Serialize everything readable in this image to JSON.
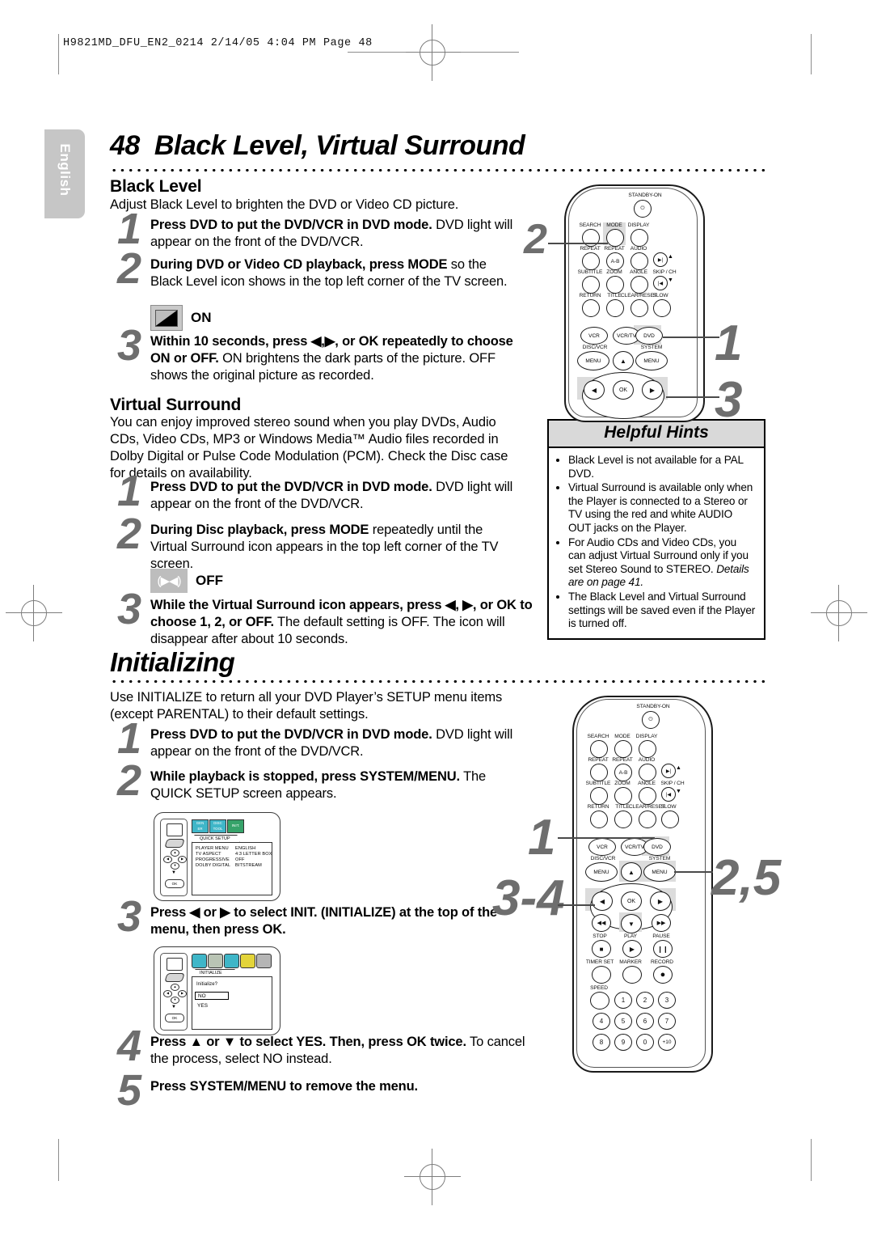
{
  "document": {
    "slug": "H9821MD_DFU_EN2_0214   2/14/05   4:04 PM   Page 48",
    "language_tab": "English",
    "page_number": "48",
    "page_title": "Black Level, Virtual Surround"
  },
  "black_level": {
    "heading": "Black Level",
    "intro": "Adjust Black Level to brighten the DVD or Video CD picture.",
    "steps": [
      {
        "n": "1",
        "bold": "Press DVD to put the DVD/VCR in DVD mode.",
        "rest": " DVD light will appear on the front of the DVD/VCR."
      },
      {
        "n": "2",
        "bold": "During DVD or Video CD playback, press MODE",
        "rest": " so the Black Level icon shows in the top left corner of the TV screen."
      },
      {
        "n": "3",
        "bold": "Within 10 seconds, press ◀,▶, or OK repeatedly to choose ON or OFF.",
        "rest": " ON brightens the dark parts of the picture. OFF shows the original picture as recorded."
      }
    ],
    "osd_icon_label": "ON",
    "osd_icon_name": "black-level-on-icon"
  },
  "virtual_surround": {
    "heading": "Virtual Surround",
    "intro": "You can enjoy improved stereo sound when you play DVDs, Audio CDs, Video CDs, MP3 or Windows Media™ Audio files recorded in Dolby Digital or Pulse Code Modulation (PCM). Check the Disc case for details on availability.",
    "steps": [
      {
        "n": "1",
        "bold": "Press DVD to put the DVD/VCR in DVD mode.",
        "rest": " DVD light will appear on the front of the DVD/VCR."
      },
      {
        "n": "2",
        "bold": "During Disc playback, press MODE",
        "rest": " repeatedly until the Virtual Surround icon appears in the top left corner of the TV screen."
      },
      {
        "n": "3",
        "bold": "While the Virtual Surround icon appears, press ◀, ▶, or OK to choose 1, 2, or OFF.",
        "rest": " The default setting is OFF. The icon will disappear after about 10 seconds."
      }
    ],
    "osd_icon_label": "OFF",
    "osd_icon_glyph": "(▶◀)"
  },
  "helpful_hints": {
    "title": "Helpful Hints",
    "items": [
      {
        "text": "Black Level is not available for a PAL DVD.",
        "italic": ""
      },
      {
        "text": "Virtual Surround is available only when the Player is connected to a Stereo or TV using the red and white AUDIO OUT jacks on the Player.",
        "italic": ""
      },
      {
        "text": "For Audio CDs and Video CDs, you can adjust Virtual Surround only if you set Stereo Sound to STEREO. ",
        "italic": "Details are on page 41."
      },
      {
        "text": "The Black Level and Virtual Surround settings will be saved even if the Player is turned off.",
        "italic": ""
      }
    ]
  },
  "initializing": {
    "heading": "Initializing",
    "intro": "Use INITIALIZE to return all your DVD Player’s SETUP menu items (except PARENTAL) to their default settings.",
    "steps": [
      {
        "n": "1",
        "bold": "Press DVD to put the DVD/VCR in DVD mode.",
        "rest": " DVD light will appear on the front of the DVD/VCR."
      },
      {
        "n": "2",
        "bold": "While playback is stopped, press SYSTEM/MENU.",
        "rest": " The QUICK SETUP screen appears."
      },
      {
        "n": "3",
        "bold": "Press ◀ or ▶ to select INIT. (INITIALIZE) at the top of the menu, then press OK.",
        "rest": ""
      },
      {
        "n": "4",
        "bold": "Press ▲ or ▼ to select YES. Then, press OK twice.",
        "rest": " To cancel the process, select NO instead."
      },
      {
        "n": "5",
        "bold": "Press SYSTEM/MENU to remove the menu.",
        "rest": ""
      }
    ]
  },
  "osd_quick_setup": {
    "tab": "QUICK SETUP",
    "tabs_icons": [
      "GENERAL",
      "DISC/TOOLS",
      "INIT."
    ],
    "rows": [
      {
        "label": "PLAYER MENU",
        "value": "ENGLISH"
      },
      {
        "label": "TV ASPECT",
        "value": "4:3 LETTER BOX"
      },
      {
        "label": "PROGRESSIVE",
        "value": "OFF"
      },
      {
        "label": "DOLBY DIGITAL",
        "value": "BITSTREAM"
      }
    ],
    "ok_label": "OK"
  },
  "osd_initialize": {
    "tab": "INITIALIZE",
    "prompt": "Initialize?",
    "options": [
      "NO",
      "YES"
    ],
    "selected": "NO",
    "ok_label": "OK"
  },
  "remote_top": {
    "standby_label": "STANDBY-ON",
    "row_labels_1": [
      "SEARCH",
      "MODE",
      "DISPLAY"
    ],
    "row_labels_2": [
      "REPEAT",
      "REPEAT",
      "AUDIO"
    ],
    "row_labels_3": [
      "SUBTITLE",
      "ZOOM",
      "ANGLE"
    ],
    "row_labels_4": [
      "RETURN",
      "TITLE",
      "CLEAR/RESET",
      "SLOW"
    ],
    "ab_label": "A-B",
    "skip_label": "SKIP / CH",
    "mode_buttons": [
      "VCR",
      "VCR/TV",
      "DVD"
    ],
    "menu_left_label": "DISC/VCR",
    "menu_right_label": "SYSTEM",
    "menu_label": "MENU",
    "ok_label": "OK",
    "callouts": [
      {
        "text": "2",
        "target": "mode-button"
      },
      {
        "text": "1",
        "target": "dvd-button"
      },
      {
        "text": "3",
        "target": "left-right-ok"
      }
    ]
  },
  "remote_bottom": {
    "standby_label": "STANDBY-ON",
    "row_labels_1": [
      "SEARCH",
      "MODE",
      "DISPLAY"
    ],
    "row_labels_2": [
      "REPEAT",
      "REPEAT",
      "AUDIO"
    ],
    "row_labels_3": [
      "SUBTITLE",
      "ZOOM",
      "ANGLE"
    ],
    "row_labels_4": [
      "RETURN",
      "TITLE",
      "CLEAR/RESET",
      "SLOW"
    ],
    "ab_label": "A-B",
    "skip_label": "SKIP / CH",
    "mode_buttons": [
      "VCR",
      "VCR/TV",
      "DVD"
    ],
    "menu_left_label": "DISC/VCR",
    "menu_right_label": "SYSTEM",
    "menu_label": "MENU",
    "ok_label": "OK",
    "transport_labels": [
      "STOP",
      "PLAY",
      "PAUSE"
    ],
    "record_labels": [
      "TIMER SET",
      "MARKER",
      "RECORD"
    ],
    "speed_label": "SPEED",
    "numbers": [
      "1",
      "2",
      "3",
      "4",
      "5",
      "6",
      "7",
      "8",
      "9",
      "0",
      "+10"
    ],
    "callouts": [
      {
        "text": "1",
        "target": "dvd-button"
      },
      {
        "text": "2,5",
        "target": "system-menu-button"
      },
      {
        "text": "3-4",
        "target": "arrow-ok-cluster"
      }
    ]
  }
}
